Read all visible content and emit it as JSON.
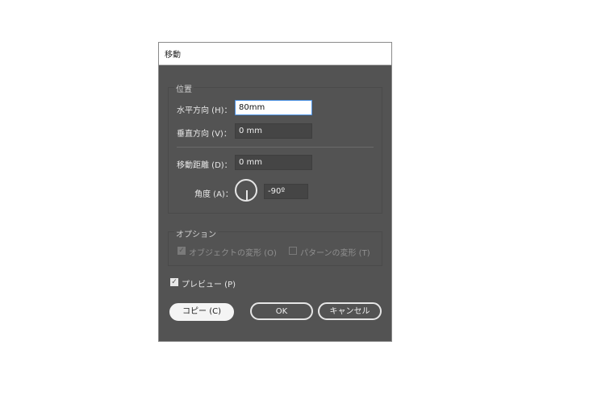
{
  "dialog": {
    "title": "移動",
    "position_group": {
      "legend": "位置",
      "horizontal_label": "水平方向 (H)：",
      "horizontal_value": "80mm",
      "vertical_label": "垂直方向 (V)：",
      "vertical_value": "0 mm",
      "distance_label": "移動距離 (D)：",
      "distance_value": "0 mm",
      "angle_label": "角度 (A)：",
      "angle_value": "-90º"
    },
    "options_group": {
      "legend": "オプション",
      "transform_objects_label": "オブジェクトの変形 (O)",
      "transform_objects_checked": true,
      "transform_patterns_label": "パターンの変形 (T)",
      "transform_patterns_checked": false
    },
    "preview_label": "プレビュー (P)",
    "preview_checked": true,
    "buttons": {
      "copy": "コピー (C)",
      "ok": "OK",
      "cancel": "キャンセル"
    }
  }
}
